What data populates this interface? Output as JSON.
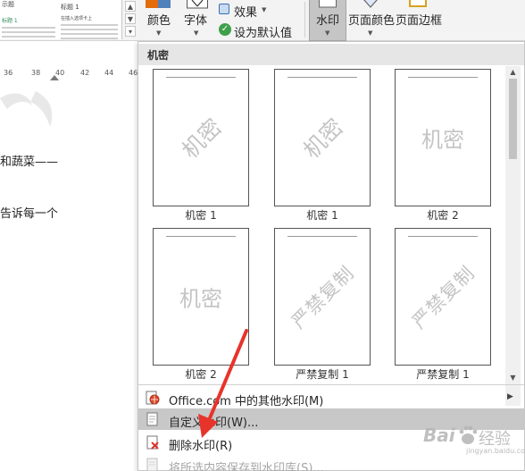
{
  "ribbon": {
    "theme_gallery": {
      "thumb1": {
        "title": "示题",
        "heading": "标题 1"
      },
      "thumb2": {
        "title": "标题 1",
        "body": "在插入选项卡上"
      }
    },
    "colors_label": "颜色",
    "fonts_label": "字体",
    "effects_label": "效果",
    "set_default_label": "设为默认值",
    "watermark_label": "水印",
    "page_color_label": "页面颜色",
    "page_borders_label": "页面边框"
  },
  "document": {
    "ruler_ticks": [
      "36",
      "38",
      "40",
      "42",
      "44",
      "46"
    ],
    "line1": "和蔬菜——",
    "line2": "告诉每一个"
  },
  "panel": {
    "section_header": "机密",
    "cards": [
      {
        "text": "机密",
        "label": "机密 1",
        "style": "diagonal"
      },
      {
        "text": "机密",
        "label": "机密 1",
        "style": "diagonal"
      },
      {
        "text": "机密",
        "label": "机密 2",
        "style": "horizontal"
      },
      {
        "text": "机密",
        "label": "机密 2",
        "style": "horizontal"
      },
      {
        "text": "严禁复制",
        "label": "严禁复制 1",
        "style": "diagonal"
      },
      {
        "text": "严禁复制",
        "label": "严禁复制 1",
        "style": "diagonal"
      }
    ],
    "menu": {
      "more_watermarks": "Office.com 中的其他水印(M)",
      "custom_watermark": "自定义水印(W)...",
      "remove_watermark": "删除水印(R)",
      "save_to_gallery": "将所选内容保存到水印库(S)..."
    }
  },
  "overlay": {
    "logo_text": "Bai",
    "logo_cn": "经验",
    "logo_url": "jingyan.baidu.com"
  },
  "colors": {
    "accent_blue": "#3a6fb6",
    "menu_highlight": "#c8c8c8",
    "arrow_red": "#e8332a"
  }
}
